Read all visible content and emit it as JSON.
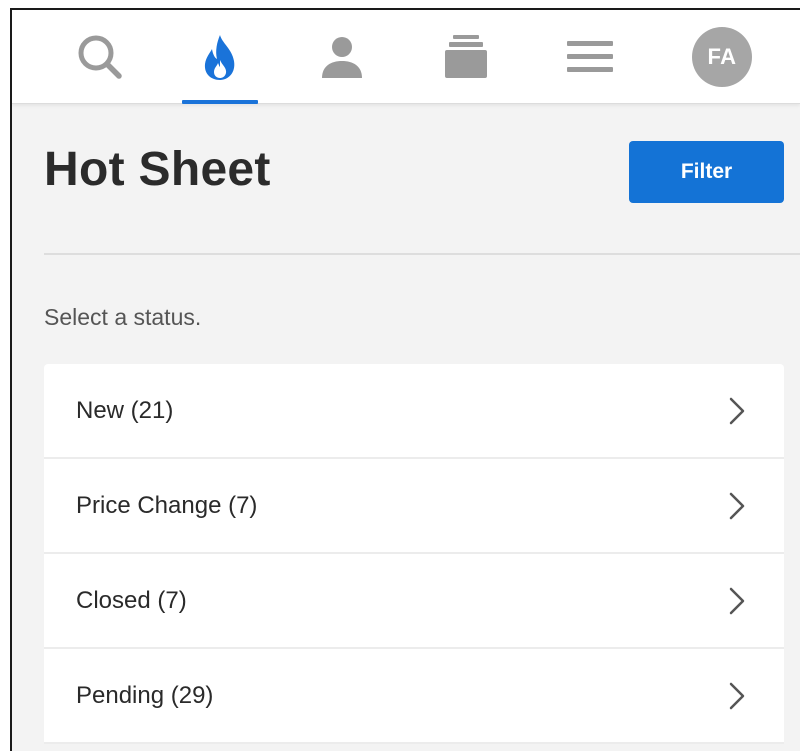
{
  "nav": {
    "items": [
      {
        "name": "search",
        "icon": "search-icon"
      },
      {
        "name": "hot-sheet",
        "icon": "flame-icon",
        "active": true
      },
      {
        "name": "contacts",
        "icon": "person-icon"
      },
      {
        "name": "saved",
        "icon": "stack-icon"
      },
      {
        "name": "menu",
        "icon": "hamburger-menu-icon"
      }
    ],
    "avatar_initials": "FA"
  },
  "header": {
    "title": "Hot Sheet",
    "filter_label": "Filter"
  },
  "hint": "Select a status.",
  "statuses": [
    {
      "label": "New (21)"
    },
    {
      "label": "Price Change (7)"
    },
    {
      "label": "Closed (7)"
    },
    {
      "label": "Pending (29)"
    }
  ],
  "colors": {
    "accent": "#1473d6",
    "icon_gray": "#9a9a9a",
    "background": "#f3f3f3"
  }
}
